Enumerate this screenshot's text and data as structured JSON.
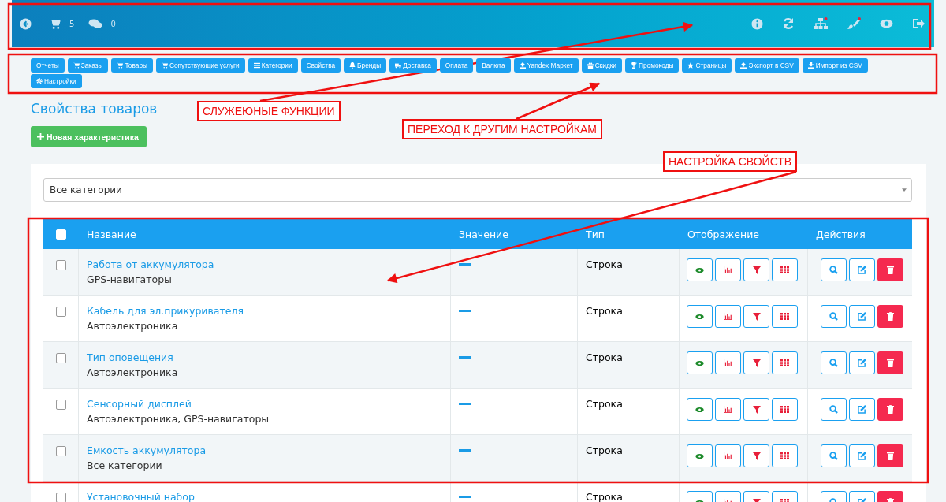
{
  "header": {
    "cart_count": "5",
    "comments_count": "0"
  },
  "nav": [
    "Отчеты",
    "Заказы",
    "Товары",
    "Сопутствующие услуги",
    "Категории",
    "Свойства",
    "Бренды",
    "Доставка",
    "Оплата",
    "Валюта",
    "Yandex Маркет",
    "Скидки",
    "Промокоды",
    "Страницы",
    "Экспорт в CSV",
    "Импорт из CSV",
    "Настройки"
  ],
  "page_title": "Свойства товаров",
  "new_button": "Новая характеристика",
  "category_select": {
    "value": "Все категории"
  },
  "table": {
    "select_all_checked": false,
    "columns": [
      "Название",
      "Значение",
      "Тип",
      "Отображение",
      "Действия"
    ],
    "rows": [
      {
        "name": "Работа от аккумулятора",
        "category": "GPS-навигаторы",
        "type": "Строка",
        "checked": false
      },
      {
        "name": "Кабель для эл.прикуривателя",
        "category": "Автоэлектроника",
        "type": "Строка",
        "checked": false
      },
      {
        "name": "Тип оповещения",
        "category": "Автоэлектроника",
        "type": "Строка",
        "checked": false
      },
      {
        "name": "Сенсорный дисплей",
        "category": "Автоэлектроника, GPS-навигаторы",
        "type": "Строка",
        "checked": false
      },
      {
        "name": "Емкость аккумулятора",
        "category": "Все категории",
        "type": "Строка",
        "checked": false
      },
      {
        "name": "Установочный набор",
        "type": "Строка",
        "checked": false
      }
    ]
  },
  "annotations": [
    "СЛУЖЕЮНЫЕ ФУНКЦИИ",
    "ПЕРЕХОД К ДРУГИМ НАСТРОЙКАМ",
    "НАСТРОЙКА СВОЙСТВ"
  ]
}
